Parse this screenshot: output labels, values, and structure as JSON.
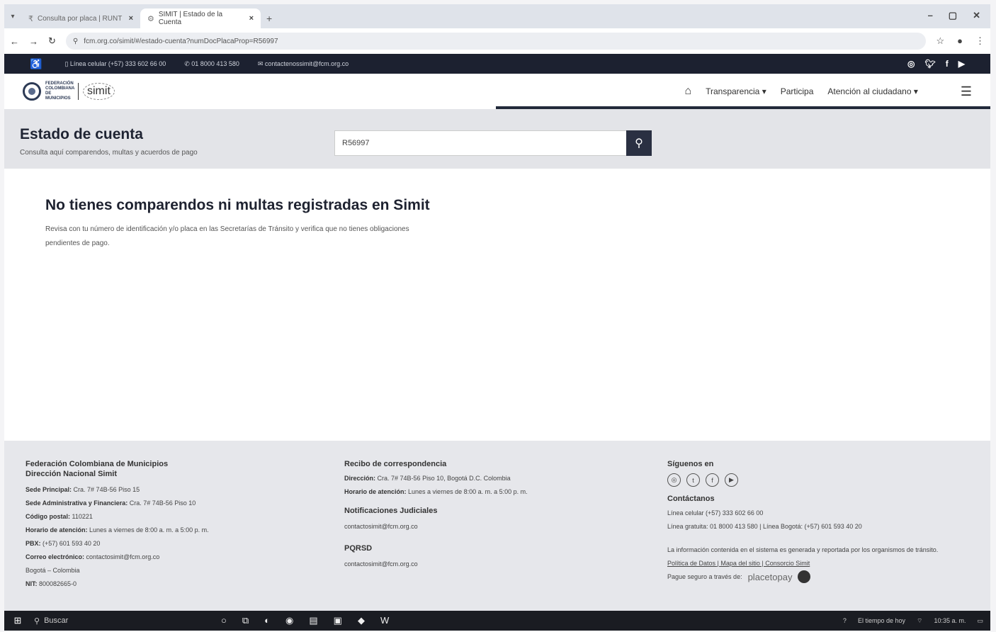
{
  "browser": {
    "tabs": [
      {
        "label": "Consulta por placa | RUNT",
        "icon": "runt-icon"
      },
      {
        "label": "SIMIT | Estado de la Cuenta",
        "icon": "simit-icon",
        "active": true
      }
    ],
    "url": "fcm.org.co/simit/#/estado-cuenta?numDocPlacaProp=R56997"
  },
  "topstrip": {
    "celular": "Línea celular (+57) 333 602 66 00",
    "gratuita": "01 8000 413 580",
    "correo": "contactenossimit@fcm.org.co"
  },
  "nav": {
    "logo_fcm": "FEDERACIÓN COLOMBIANA DE MUNICIPIOS",
    "logo_simit": "simit",
    "items": [
      "Transparencia",
      "Participa",
      "Atención al ciudadano"
    ]
  },
  "header": {
    "title": "Estado de cuenta",
    "subtitle": "Consulta aquí comparendos, multas y acuerdos de pago",
    "search_value": "R56997"
  },
  "main": {
    "heading": "No tienes comparendos ni multas registradas en Simit",
    "text": "Revisa con tu número de identificación y/o placa en las Secretarías de Tránsito y verifica que no tienes obligaciones pendientes de pago."
  },
  "footer": {
    "col1": {
      "title1": "Federación Colombiana de Municipios",
      "title2": "Dirección Nacional Simit",
      "lines": [
        {
          "k": "Sede Principal:",
          "v": "Cra. 7# 74B-56 Piso 15"
        },
        {
          "k": "Sede Administrativa y Financiera:",
          "v": "Cra. 7# 74B-56 Piso 10"
        },
        {
          "k": "Código postal:",
          "v": "110221"
        },
        {
          "k": "Horario de atención:",
          "v": "Lunes a viernes de 8:00 a. m. a 5:00 p. m."
        },
        {
          "k": "PBX:",
          "v": "(+57) 601 593 40 20"
        },
        {
          "k": "Correo electrónico:",
          "v": "contactosimit@fcm.org.co"
        },
        {
          "k": "",
          "v": "Bogotá – Colombia"
        },
        {
          "k": "NIT:",
          "v": "800082665-0"
        }
      ]
    },
    "col2": {
      "title_rec": "Recibo de correspondencia",
      "direccion_k": "Dirección:",
      "direccion_v": "Cra. 7# 74B-56 Piso 10, Bogotá D.C. Colombia",
      "horario_k": "Horario de atención:",
      "horario_v": "Lunes a viernes de 8:00 a. m. a 5:00 p. m.",
      "title_not": "Notificaciones Judiciales",
      "not_email": "contactosimit@fcm.org.co",
      "title_pqrsd": "PQRSD",
      "pqrsd_email": "contactosimit@fcm.org.co"
    },
    "col3": {
      "siguenos": "Síguenos en",
      "contactanos": "Contáctanos",
      "celular": "Línea celular (+57) 333 602 66 00",
      "gratuita": "Línea gratuita: 01 8000 413 580 | Línea Bogotá: (+57) 601 593 40 20",
      "info": "La información contenida en el sistema es generada y reportada por los organismos de tránsito.",
      "links": "Política de Datos | Mapa del sitio | Consorcio Simit",
      "paga": "Pague seguro a través de:",
      "pz_brand": "placetopay"
    }
  },
  "taskbar": {
    "search": "Buscar",
    "weather": "El tiempo de hoy",
    "time": "10:35 a. m."
  }
}
